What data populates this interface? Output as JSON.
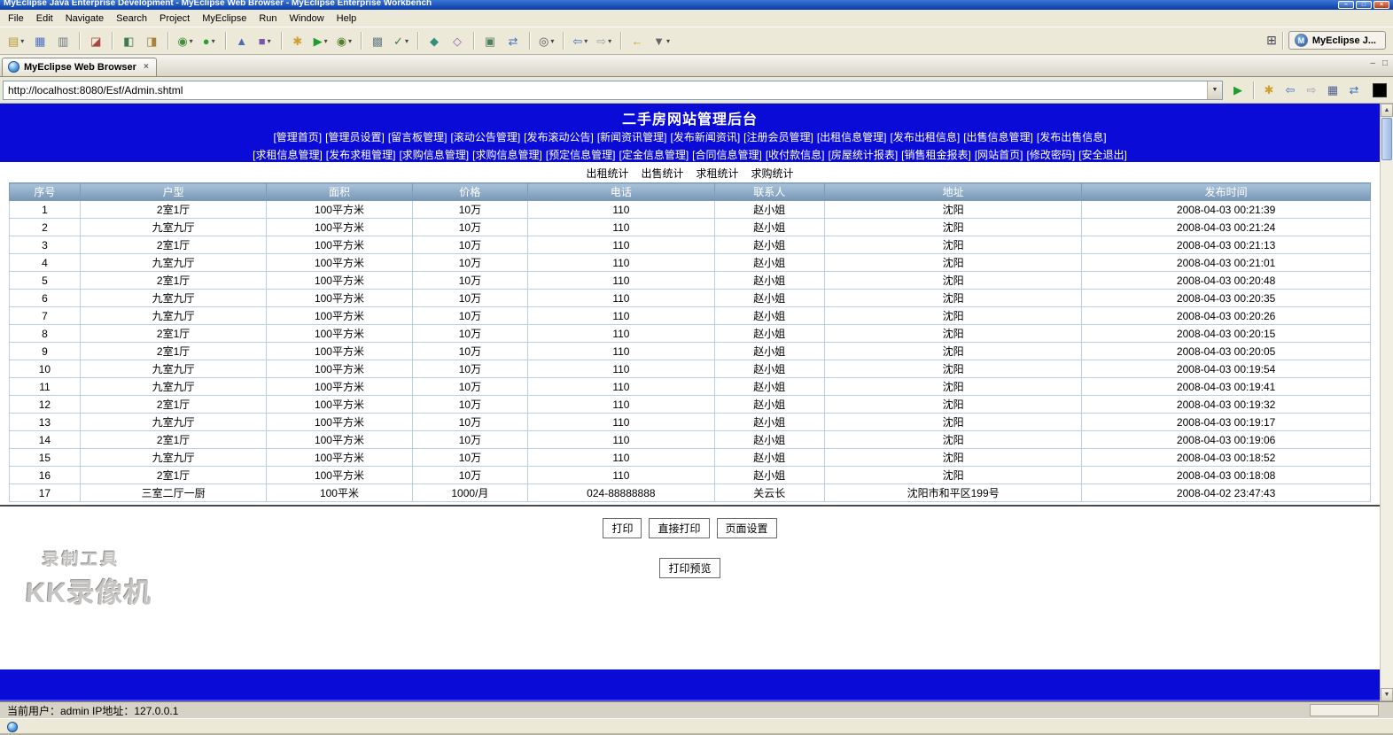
{
  "window": {
    "title": "MyEclipse Java Enterprise Development - MyEclipse Web Browser - MyEclipse Enterprise Workbench"
  },
  "menubar": {
    "items": [
      "File",
      "Edit",
      "Navigate",
      "Search",
      "Project",
      "MyEclipse",
      "Run",
      "Window",
      "Help"
    ]
  },
  "toolbar": {
    "icons": [
      {
        "name": "new-wizard-icon",
        "glyph": "▤",
        "color": "#b9972f",
        "dropdown": true
      },
      {
        "name": "save-icon",
        "glyph": "▦",
        "color": "#4f6fc0"
      },
      {
        "name": "print-icon",
        "glyph": "▥",
        "color": "#6f7780"
      },
      {
        "name": "separator"
      },
      {
        "name": "new-project-icon",
        "glyph": "◪",
        "color": "#a94545"
      },
      {
        "name": "separator"
      },
      {
        "name": "run-ant-icon",
        "glyph": "◧",
        "color": "#3f7a4f"
      },
      {
        "name": "external-tools-icon",
        "glyph": "◨",
        "color": "#a9813a"
      },
      {
        "name": "separator"
      },
      {
        "name": "debug-config-icon",
        "glyph": "◉",
        "color": "#3f8f3f",
        "dropdown": true
      },
      {
        "name": "run-config-icon",
        "glyph": "●",
        "color": "#2f9e2f",
        "dropdown": true
      },
      {
        "name": "separator"
      },
      {
        "name": "deploy-icon",
        "glyph": "▲",
        "color": "#4a6fae"
      },
      {
        "name": "server-icon",
        "glyph": "■",
        "color": "#7a55ae",
        "dropdown": true
      },
      {
        "name": "separator"
      },
      {
        "name": "quick-launch-icon",
        "glyph": "✱",
        "color": "#cf9f2f"
      },
      {
        "name": "run-icon",
        "glyph": "▶",
        "color": "#1f9e2f",
        "dropdown": true
      },
      {
        "name": "debug-icon",
        "glyph": "◉",
        "color": "#557f2f",
        "dropdown": true
      },
      {
        "name": "separator"
      },
      {
        "name": "build-icon",
        "glyph": "▩",
        "color": "#70808e"
      },
      {
        "name": "validate-icon",
        "glyph": "✓",
        "color": "#2f7e3f",
        "dropdown": true
      },
      {
        "name": "separator"
      },
      {
        "name": "new-class-icon",
        "glyph": "◆",
        "color": "#2f8f7f"
      },
      {
        "name": "new-package-icon",
        "glyph": "◇",
        "color": "#8f5faf"
      },
      {
        "name": "separator"
      },
      {
        "name": "db-explorer-icon",
        "glyph": "▣",
        "color": "#4f7f5f"
      },
      {
        "name": "sync-icon",
        "glyph": "⇄",
        "color": "#3f6fbf"
      },
      {
        "name": "separator"
      },
      {
        "name": "search-icon",
        "glyph": "◎",
        "color": "#555555",
        "dropdown": true
      },
      {
        "name": "separator"
      },
      {
        "name": "back-icon",
        "glyph": "⇦",
        "color": "#3f6fbf",
        "dropdown": true
      },
      {
        "name": "forward-icon",
        "glyph": "⇨",
        "color": "#9aa2ae",
        "dropdown": true
      },
      {
        "name": "separator"
      },
      {
        "name": "last-edit-location-icon",
        "glyph": "←",
        "color": "#caa227"
      },
      {
        "name": "annotations-icon",
        "glyph": "▼",
        "color": "#666666",
        "dropdown": true
      }
    ]
  },
  "perspective": {
    "label": "MyEclipse J..."
  },
  "tab": {
    "label": "MyEclipse Web Browser"
  },
  "urlbar": {
    "value": "http://localhost:8080/Esf/Admin.shtml",
    "actions": [
      {
        "name": "go-icon",
        "glyph": "▶",
        "color": "#1f9e2f"
      },
      {
        "name": "separator"
      },
      {
        "name": "highlight-icon",
        "glyph": "✱",
        "color": "#cf9f2f"
      },
      {
        "name": "back-icon",
        "glyph": "⇦",
        "color": "#3f6fbf"
      },
      {
        "name": "forward-icon",
        "glyph": "⇨",
        "color": "#9aa2ae"
      },
      {
        "name": "monitor-icon",
        "glyph": "▦",
        "color": "#4f5f8f"
      },
      {
        "name": "refresh-icon",
        "glyph": "⇄",
        "color": "#3f6fbf"
      }
    ]
  },
  "icons": {
    "close": "×",
    "minimize": "–",
    "maximize": "□",
    "dropdown_down": "▼",
    "scroll_up": "▲",
    "scroll_down": "▼",
    "open_perspective": "⊞",
    "view_minimize": "–",
    "view_maximize": "□",
    "perspective_letter": "M"
  },
  "page": {
    "title": "二手房网站管理后台",
    "nav_row1": [
      "[管理首页]",
      "[管理员设置]",
      "[留言板管理]",
      "[滚动公告管理]",
      "[发布滚动公告]",
      "[新闻资讯管理]",
      "[发布新闻资讯]",
      "[注册会员管理]",
      "[出租信息管理]",
      "[发布出租信息]",
      "[出售信息管理]",
      "[发布出售信息]"
    ],
    "nav_row2": [
      "[求租信息管理]",
      "[发布求租管理]",
      "[求购信息管理]",
      "[求购信息管理]",
      "[预定信息管理]",
      "[定金信息管理]",
      "[合同信息管理]",
      "[收付款信息]",
      "[房屋统计报表]",
      "[销售租金报表]",
      "[网站首页]",
      "[修改密码]",
      "[安全退出]"
    ],
    "stats_links": [
      "出租统计",
      "出售统计",
      "求租统计",
      "求购统计"
    ],
    "table": {
      "headers": [
        "序号",
        "户型",
        "面积",
        "价格",
        "电话",
        "联系人",
        "地址",
        "发布时间"
      ],
      "rows": [
        [
          "1",
          "2室1厅",
          "100平方米",
          "10万",
          "110",
          "赵小姐",
          "沈阳",
          "2008-04-03 00:21:39"
        ],
        [
          "2",
          "九室九厅",
          "100平方米",
          "10万",
          "110",
          "赵小姐",
          "沈阳",
          "2008-04-03 00:21:24"
        ],
        [
          "3",
          "2室1厅",
          "100平方米",
          "10万",
          "110",
          "赵小姐",
          "沈阳",
          "2008-04-03 00:21:13"
        ],
        [
          "4",
          "九室九厅",
          "100平方米",
          "10万",
          "110",
          "赵小姐",
          "沈阳",
          "2008-04-03 00:21:01"
        ],
        [
          "5",
          "2室1厅",
          "100平方米",
          "10万",
          "110",
          "赵小姐",
          "沈阳",
          "2008-04-03 00:20:48"
        ],
        [
          "6",
          "九室九厅",
          "100平方米",
          "10万",
          "110",
          "赵小姐",
          "沈阳",
          "2008-04-03 00:20:35"
        ],
        [
          "7",
          "九室九厅",
          "100平方米",
          "10万",
          "110",
          "赵小姐",
          "沈阳",
          "2008-04-03 00:20:26"
        ],
        [
          "8",
          "2室1厅",
          "100平方米",
          "10万",
          "110",
          "赵小姐",
          "沈阳",
          "2008-04-03 00:20:15"
        ],
        [
          "9",
          "2室1厅",
          "100平方米",
          "10万",
          "110",
          "赵小姐",
          "沈阳",
          "2008-04-03 00:20:05"
        ],
        [
          "10",
          "九室九厅",
          "100平方米",
          "10万",
          "110",
          "赵小姐",
          "沈阳",
          "2008-04-03 00:19:54"
        ],
        [
          "11",
          "九室九厅",
          "100平方米",
          "10万",
          "110",
          "赵小姐",
          "沈阳",
          "2008-04-03 00:19:41"
        ],
        [
          "12",
          "2室1厅",
          "100平方米",
          "10万",
          "110",
          "赵小姐",
          "沈阳",
          "2008-04-03 00:19:32"
        ],
        [
          "13",
          "九室九厅",
          "100平方米",
          "10万",
          "110",
          "赵小姐",
          "沈阳",
          "2008-04-03 00:19:17"
        ],
        [
          "14",
          "2室1厅",
          "100平方米",
          "10万",
          "110",
          "赵小姐",
          "沈阳",
          "2008-04-03 00:19:06"
        ],
        [
          "15",
          "九室九厅",
          "100平方米",
          "10万",
          "110",
          "赵小姐",
          "沈阳",
          "2008-04-03 00:18:52"
        ],
        [
          "16",
          "2室1厅",
          "100平方米",
          "10万",
          "110",
          "赵小姐",
          "沈阳",
          "2008-04-03 00:18:08"
        ],
        [
          "17",
          "三室二厅一厨",
          "100平米",
          "1000/月",
          "024-88888888",
          "关云长",
          "沈阳市和平区199号",
          "2008-04-02 23:47:43"
        ]
      ]
    },
    "print_buttons": [
      "打印",
      "直接打印",
      "页面设置"
    ],
    "preview_button": "打印预览",
    "status_user": "当前用户：admin  IP地址：127.0.0.1"
  },
  "watermark": {
    "line1": "录制工具",
    "line2": "KK录像机"
  },
  "colors": {
    "banner_blue": "#0b0bd8",
    "table_header_top": "#a9c3da",
    "table_header_bottom": "#7897b6",
    "table_border": "#b9cfe2",
    "titlebar_blue": "#0a3ba6"
  }
}
